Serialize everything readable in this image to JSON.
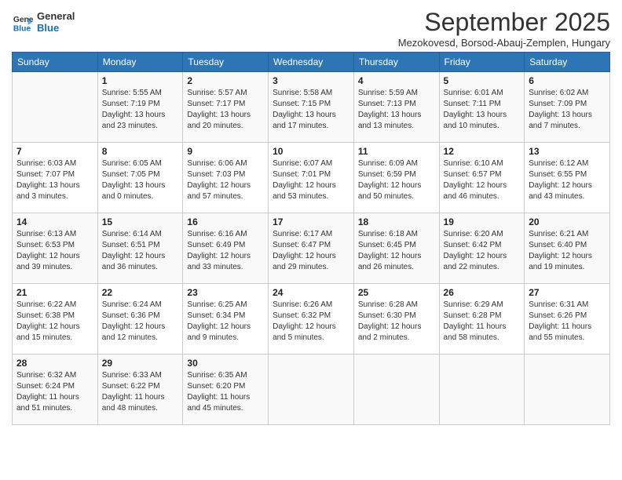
{
  "logo": {
    "line1": "General",
    "line2": "Blue"
  },
  "title": "September 2025",
  "subtitle": "Mezokovesd, Borsod-Abauj-Zemplen, Hungary",
  "days_of_week": [
    "Sunday",
    "Monday",
    "Tuesday",
    "Wednesday",
    "Thursday",
    "Friday",
    "Saturday"
  ],
  "weeks": [
    [
      {
        "day": "",
        "info": ""
      },
      {
        "day": "1",
        "info": "Sunrise: 5:55 AM\nSunset: 7:19 PM\nDaylight: 13 hours\nand 23 minutes."
      },
      {
        "day": "2",
        "info": "Sunrise: 5:57 AM\nSunset: 7:17 PM\nDaylight: 13 hours\nand 20 minutes."
      },
      {
        "day": "3",
        "info": "Sunrise: 5:58 AM\nSunset: 7:15 PM\nDaylight: 13 hours\nand 17 minutes."
      },
      {
        "day": "4",
        "info": "Sunrise: 5:59 AM\nSunset: 7:13 PM\nDaylight: 13 hours\nand 13 minutes."
      },
      {
        "day": "5",
        "info": "Sunrise: 6:01 AM\nSunset: 7:11 PM\nDaylight: 13 hours\nand 10 minutes."
      },
      {
        "day": "6",
        "info": "Sunrise: 6:02 AM\nSunset: 7:09 PM\nDaylight: 13 hours\nand 7 minutes."
      }
    ],
    [
      {
        "day": "7",
        "info": "Sunrise: 6:03 AM\nSunset: 7:07 PM\nDaylight: 13 hours\nand 3 minutes."
      },
      {
        "day": "8",
        "info": "Sunrise: 6:05 AM\nSunset: 7:05 PM\nDaylight: 13 hours\nand 0 minutes."
      },
      {
        "day": "9",
        "info": "Sunrise: 6:06 AM\nSunset: 7:03 PM\nDaylight: 12 hours\nand 57 minutes."
      },
      {
        "day": "10",
        "info": "Sunrise: 6:07 AM\nSunset: 7:01 PM\nDaylight: 12 hours\nand 53 minutes."
      },
      {
        "day": "11",
        "info": "Sunrise: 6:09 AM\nSunset: 6:59 PM\nDaylight: 12 hours\nand 50 minutes."
      },
      {
        "day": "12",
        "info": "Sunrise: 6:10 AM\nSunset: 6:57 PM\nDaylight: 12 hours\nand 46 minutes."
      },
      {
        "day": "13",
        "info": "Sunrise: 6:12 AM\nSunset: 6:55 PM\nDaylight: 12 hours\nand 43 minutes."
      }
    ],
    [
      {
        "day": "14",
        "info": "Sunrise: 6:13 AM\nSunset: 6:53 PM\nDaylight: 12 hours\nand 39 minutes."
      },
      {
        "day": "15",
        "info": "Sunrise: 6:14 AM\nSunset: 6:51 PM\nDaylight: 12 hours\nand 36 minutes."
      },
      {
        "day": "16",
        "info": "Sunrise: 6:16 AM\nSunset: 6:49 PM\nDaylight: 12 hours\nand 33 minutes."
      },
      {
        "day": "17",
        "info": "Sunrise: 6:17 AM\nSunset: 6:47 PM\nDaylight: 12 hours\nand 29 minutes."
      },
      {
        "day": "18",
        "info": "Sunrise: 6:18 AM\nSunset: 6:45 PM\nDaylight: 12 hours\nand 26 minutes."
      },
      {
        "day": "19",
        "info": "Sunrise: 6:20 AM\nSunset: 6:42 PM\nDaylight: 12 hours\nand 22 minutes."
      },
      {
        "day": "20",
        "info": "Sunrise: 6:21 AM\nSunset: 6:40 PM\nDaylight: 12 hours\nand 19 minutes."
      }
    ],
    [
      {
        "day": "21",
        "info": "Sunrise: 6:22 AM\nSunset: 6:38 PM\nDaylight: 12 hours\nand 15 minutes."
      },
      {
        "day": "22",
        "info": "Sunrise: 6:24 AM\nSunset: 6:36 PM\nDaylight: 12 hours\nand 12 minutes."
      },
      {
        "day": "23",
        "info": "Sunrise: 6:25 AM\nSunset: 6:34 PM\nDaylight: 12 hours\nand 9 minutes."
      },
      {
        "day": "24",
        "info": "Sunrise: 6:26 AM\nSunset: 6:32 PM\nDaylight: 12 hours\nand 5 minutes."
      },
      {
        "day": "25",
        "info": "Sunrise: 6:28 AM\nSunset: 6:30 PM\nDaylight: 12 hours\nand 2 minutes."
      },
      {
        "day": "26",
        "info": "Sunrise: 6:29 AM\nSunset: 6:28 PM\nDaylight: 11 hours\nand 58 minutes."
      },
      {
        "day": "27",
        "info": "Sunrise: 6:31 AM\nSunset: 6:26 PM\nDaylight: 11 hours\nand 55 minutes."
      }
    ],
    [
      {
        "day": "28",
        "info": "Sunrise: 6:32 AM\nSunset: 6:24 PM\nDaylight: 11 hours\nand 51 minutes."
      },
      {
        "day": "29",
        "info": "Sunrise: 6:33 AM\nSunset: 6:22 PM\nDaylight: 11 hours\nand 48 minutes."
      },
      {
        "day": "30",
        "info": "Sunrise: 6:35 AM\nSunset: 6:20 PM\nDaylight: 11 hours\nand 45 minutes."
      },
      {
        "day": "",
        "info": ""
      },
      {
        "day": "",
        "info": ""
      },
      {
        "day": "",
        "info": ""
      },
      {
        "day": "",
        "info": ""
      }
    ]
  ]
}
